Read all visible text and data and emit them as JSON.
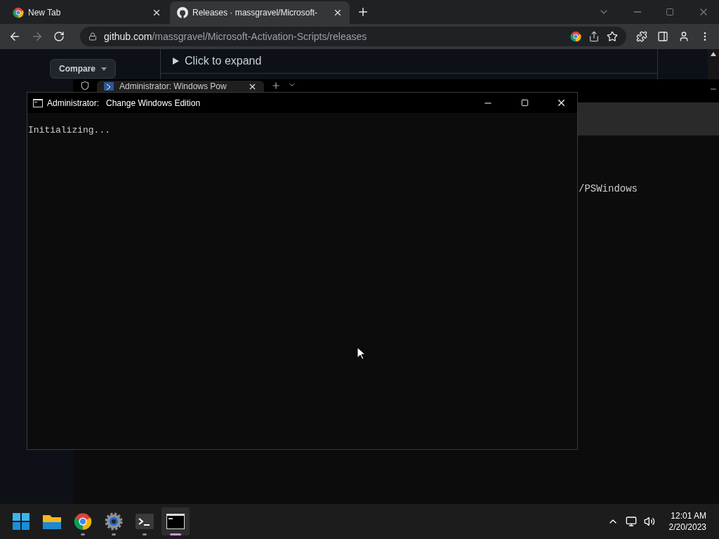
{
  "browser": {
    "tabs": [
      {
        "title": "New Tab",
        "selected": false
      },
      {
        "title": "Releases · massgravel/Microsoft-",
        "selected": true
      }
    ],
    "address": {
      "domain": "github.com",
      "path": "/massgravel/Microsoft-Activation-Scripts/releases"
    },
    "page": {
      "compare_button": "Compare",
      "expander": {
        "label": "Click to expand",
        "expanded": false
      }
    }
  },
  "terminal": {
    "tab_title": "Administrator: Windows Pow",
    "output_text": "/PSWindows"
  },
  "console": {
    "title_prefix": "Administrator:",
    "title": "Change Windows Edition",
    "output": "Initializing..."
  },
  "taskbar": {
    "apps": [
      {
        "kind": "start",
        "running": false,
        "selected": false
      },
      {
        "kind": "explorer",
        "running": false,
        "selected": false
      },
      {
        "kind": "chrome",
        "running": true,
        "selected": false
      },
      {
        "kind": "settings",
        "running": true,
        "selected": false
      },
      {
        "kind": "terminal",
        "running": true,
        "selected": false
      },
      {
        "kind": "console",
        "running": true,
        "selected": true
      }
    ],
    "clock": {
      "time": "12:01 AM",
      "date": "2/20/2023"
    }
  }
}
